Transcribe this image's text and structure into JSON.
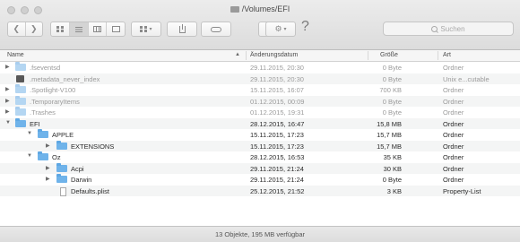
{
  "window": {
    "title": "/Volumes/EFI"
  },
  "toolbar": {
    "help": "?"
  },
  "search": {
    "placeholder": "Suchen"
  },
  "columns": {
    "name": "Name",
    "date": "Änderungsdatum",
    "size": "Größe",
    "kind": "Art"
  },
  "rows": [
    {
      "name": ".fseventsd",
      "date": "29.11.2015, 20:30",
      "size": "0 Byte",
      "kind": "Ordner"
    },
    {
      "name": ".metadata_never_index",
      "date": "29.11.2015, 20:30",
      "size": "0 Byte",
      "kind": "Unix e...cutable"
    },
    {
      "name": ".Spotlight-V100",
      "date": "15.11.2015, 16:07",
      "size": "700 KB",
      "kind": "Ordner"
    },
    {
      "name": ".TemporaryItems",
      "date": "01.12.2015, 00:09",
      "size": "0 Byte",
      "kind": "Ordner"
    },
    {
      "name": ".Trashes",
      "date": "01.12.2015, 19:31",
      "size": "0 Byte",
      "kind": "Ordner"
    },
    {
      "name": "EFI",
      "date": "28.12.2015, 16:47",
      "size": "15,8 MB",
      "kind": "Ordner"
    },
    {
      "name": "APPLE",
      "date": "15.11.2015, 17:23",
      "size": "15,7 MB",
      "kind": "Ordner"
    },
    {
      "name": "EXTENSIONS",
      "date": "15.11.2015, 17:23",
      "size": "15,7 MB",
      "kind": "Ordner"
    },
    {
      "name": "Oz",
      "date": "28.12.2015, 16:53",
      "size": "35 KB",
      "kind": "Ordner"
    },
    {
      "name": "Acpi",
      "date": "29.11.2015, 21:24",
      "size": "30 KB",
      "kind": "Ordner"
    },
    {
      "name": "Darwin",
      "date": "29.11.2015, 21:24",
      "size": "0 Byte",
      "kind": "Ordner"
    },
    {
      "name": "Defaults.plist",
      "date": "25.12.2015, 21:52",
      "size": "3 KB",
      "kind": "Property-List"
    }
  ],
  "status": {
    "text": "13 Objekte, 195 MB verfügbar"
  }
}
